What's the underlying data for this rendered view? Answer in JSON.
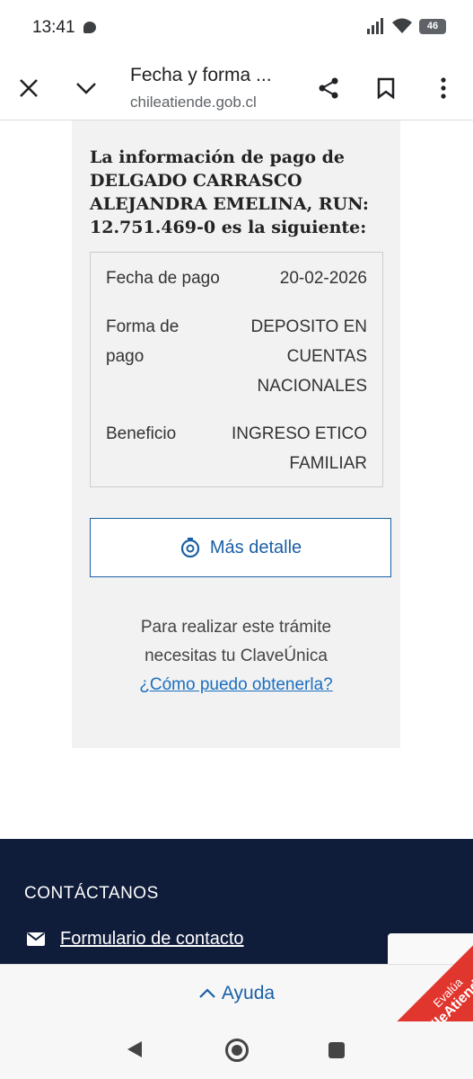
{
  "status": {
    "time": "13:41",
    "battery": "46"
  },
  "topbar": {
    "title": "Fecha y forma ...",
    "url": "chileatiende.gob.cl"
  },
  "card": {
    "intro": "La información de pago de DELGADO CARRASCO ALEJANDRA EMELINA, RUN: 12.751.469-0 es la siguiente:",
    "rows": [
      {
        "label": "Fecha de pago",
        "value": "20-02-2026"
      },
      {
        "label": "Forma de pago",
        "value": "DEPOSITO EN CUENTAS NACIONALES"
      },
      {
        "label": "Beneficio",
        "value": "INGRESO ETICO FAMILIAR"
      }
    ],
    "detail_button": "Más detalle",
    "info_line1": "Para realizar este trámite",
    "info_line2": "necesitas tu ClaveÚnica",
    "info_link": "¿Cómo puedo obtenerla?"
  },
  "footer": {
    "contact_title": "CONTÁCTANOS",
    "contact_link": "Formulario de contacto"
  },
  "help": {
    "label": "Ayuda"
  },
  "ribbon": {
    "line1": "Evalúa",
    "line2": "ChileAtiende.cl"
  },
  "colors": {
    "primary": "#1a5fa6",
    "footer_bg": "#0f1c3a",
    "ribbon": "#e1362e"
  }
}
